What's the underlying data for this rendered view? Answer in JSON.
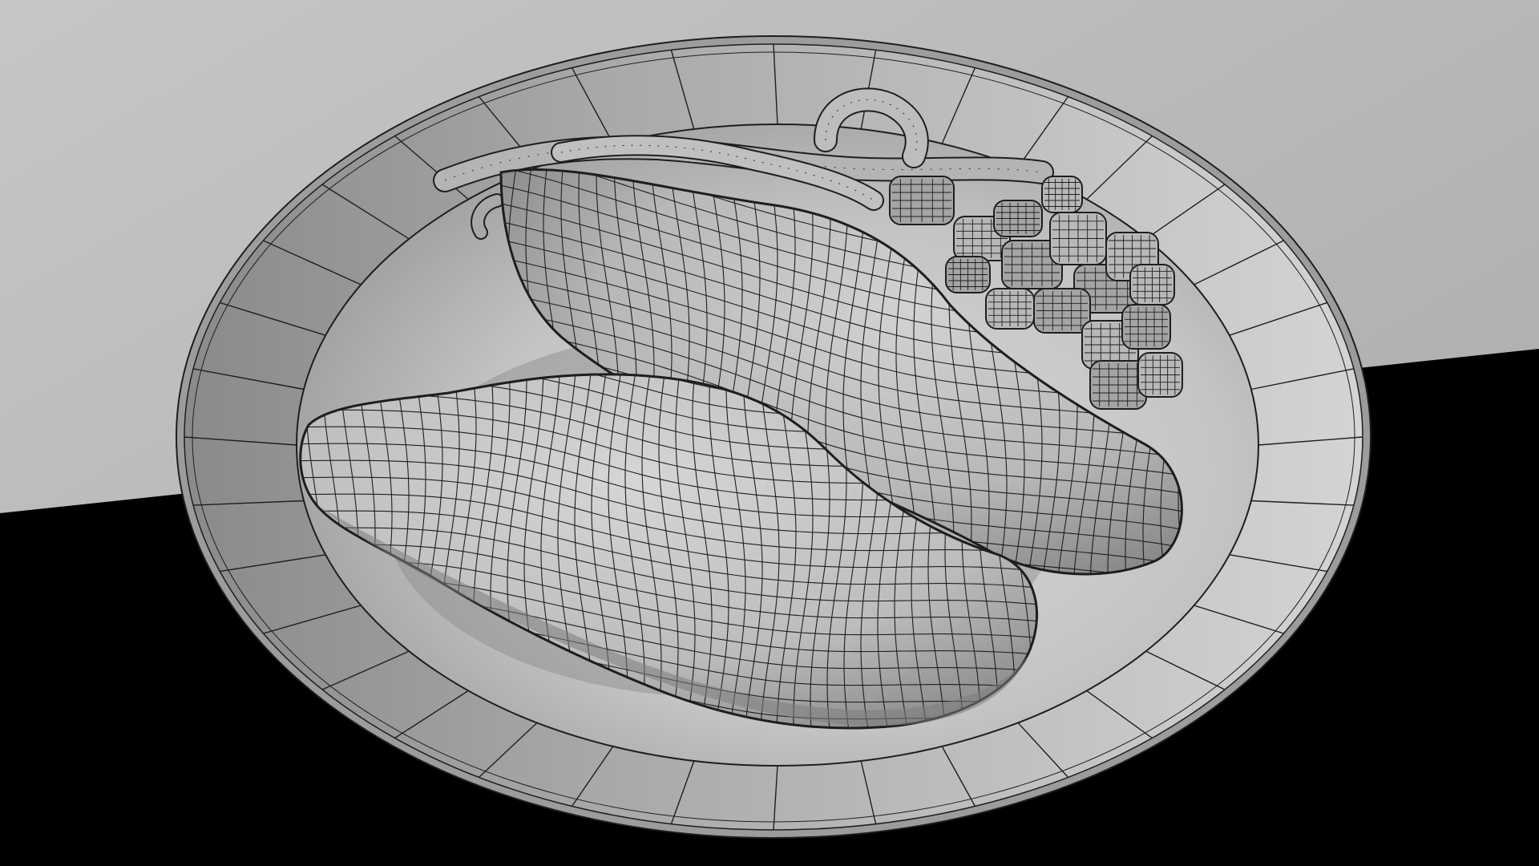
{
  "scene": {
    "render_style": "wireframe-on-shaded",
    "subject": "plate-with-food-mesh",
    "colors": {
      "backdrop_top": "#b8b8b8",
      "floor": "#000000",
      "plate_fill": "#cfcfcf",
      "plate_shadow_side": "#8e8e8e",
      "mesh_fill": "#c4c4c4",
      "mesh_shadow": "#7c7c7c",
      "wire": "#1e1e1e"
    }
  }
}
